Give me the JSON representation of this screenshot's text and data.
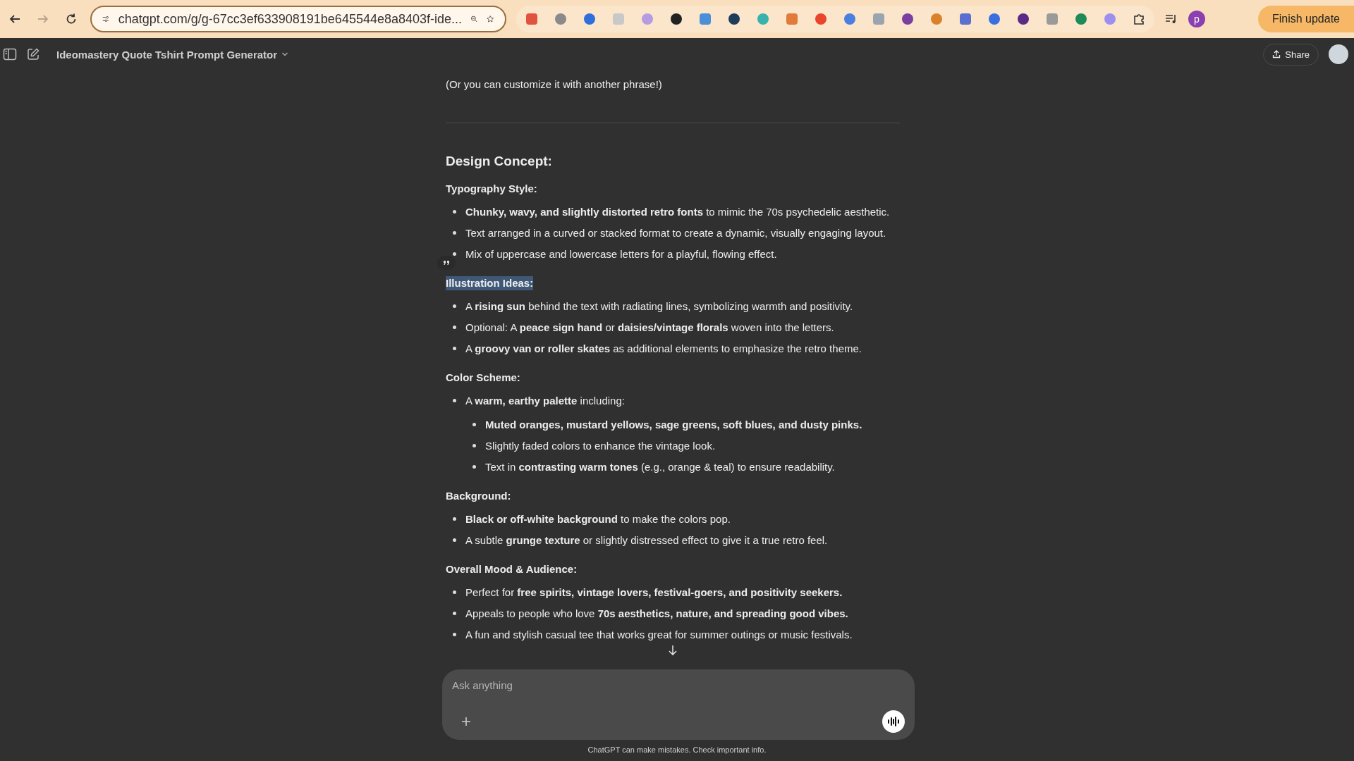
{
  "browser": {
    "url": "chatgpt.com/g/g-67cc3ef633908191be645544e8a8403f-ide...",
    "profile_initial": "p",
    "update_button": "Finish update"
  },
  "header": {
    "title": "Ideomastery Quote Tshirt Prompt Generator",
    "share": "Share"
  },
  "chat": {
    "intro": "(Or you can customize it with another phrase!)",
    "heading": "Design Concept:",
    "sections": [
      {
        "title": "Typography Style:",
        "highlighted": false,
        "items": [
          {
            "text": "**Chunky, wavy, and slightly distorted retro fonts** to mimic the 70s psychedelic aesthetic."
          },
          {
            "text": "Text arranged in a curved or stacked format to create a dynamic, visually engaging layout."
          },
          {
            "text": "Mix of uppercase and lowercase letters for a playful, flowing effect."
          }
        ]
      },
      {
        "title": "Illustration Ideas:",
        "highlighted": true,
        "items": [
          {
            "text": "A **rising sun** behind the text with radiating lines, symbolizing warmth and positivity."
          },
          {
            "text": "Optional: A **peace sign hand** or **daisies/vintage florals** woven into the letters."
          },
          {
            "text": "A **groovy van or roller skates** as additional elements to emphasize the retro theme."
          }
        ]
      },
      {
        "title": "Color Scheme:",
        "highlighted": false,
        "items": [
          {
            "text": "A **warm, earthy palette** including:",
            "children": [
              {
                "text": "**Muted oranges, mustard yellows, sage greens, soft blues, and dusty pinks.**"
              },
              {
                "text": "Slightly faded colors to enhance the vintage look."
              },
              {
                "text": "Text in **contrasting warm tones** (e.g., orange & teal) to ensure readability."
              }
            ]
          }
        ]
      },
      {
        "title": "Background:",
        "highlighted": false,
        "items": [
          {
            "text": "**Black or off-white background** to make the colors pop."
          },
          {
            "text": "A subtle **grunge texture** or slightly distressed effect to give it a true retro feel."
          }
        ]
      },
      {
        "title": "Overall Mood & Audience:",
        "highlighted": false,
        "items": [
          {
            "text": "Perfect for **free spirits, vintage lovers, festival-goers, and positivity seekers.**"
          },
          {
            "text": "Appeals to people who love **70s aesthetics, nature, and spreading good vibes.**"
          },
          {
            "text": "A fun and stylish casual tee that works great for summer outings or music festivals."
          }
        ]
      }
    ]
  },
  "composer": {
    "placeholder": "Ask anything"
  },
  "disclaimer": "ChatGPT can make mistakes. Check important info."
}
